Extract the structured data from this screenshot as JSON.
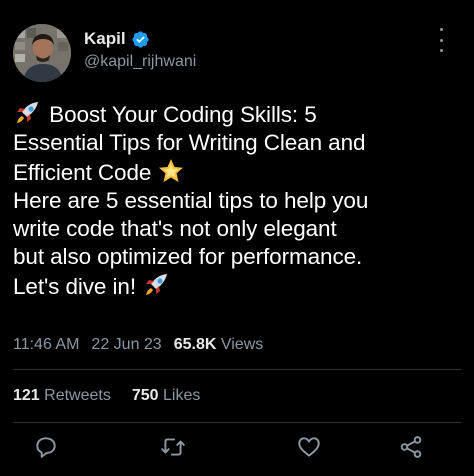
{
  "author": {
    "display_name": "Kapil",
    "handle": "@kapil_rijhwani",
    "verified": true
  },
  "tweet": {
    "lines": [
      "Boost Your Coding Skills: 5",
      "Essential Tips for Writing Clean and",
      "Efficient Code",
      "Here are 5 essential tips to help you",
      "write code that's not only elegant",
      "but also optimized for performance.",
      "Let's dive in!"
    ],
    "emojis": [
      "rocket-icon",
      "glowing-star-icon",
      "rocket-icon"
    ]
  },
  "meta": {
    "time": "11:46 AM",
    "date": "22 Jun 23",
    "views_count": "65.8K",
    "views_label": "Views"
  },
  "stats": {
    "retweets_count": "121",
    "retweets_label": "Retweets",
    "likes_count": "750",
    "likes_label": "Likes"
  },
  "actions": [
    "reply-icon",
    "retweet-icon",
    "like-icon",
    "share-icon"
  ],
  "colors": {
    "background": "#000000",
    "text": "#e7e9ea",
    "secondary": "#8b98a5",
    "verified": "#1d9bf0",
    "divider": "#2f3336"
  }
}
